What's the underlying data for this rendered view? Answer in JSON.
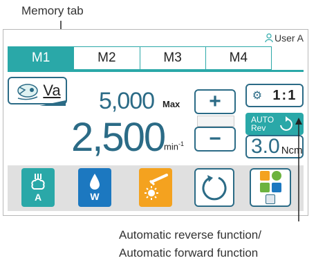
{
  "callouts": {
    "memory_tab": "Memory tab",
    "auto_reverse_line1": "Automatic reverse function/",
    "auto_reverse_line2": "Automatic forward  function"
  },
  "header": {
    "user_label": "User A"
  },
  "tabs": [
    {
      "label": "M1",
      "active": true
    },
    {
      "label": "M2",
      "active": false
    },
    {
      "label": "M3",
      "active": false
    },
    {
      "label": "M4",
      "active": false
    }
  ],
  "motor": {
    "mode_label": "Va",
    "max_speed": "5,000",
    "max_label": "Max",
    "speed": "2,500",
    "speed_unit": "min",
    "speed_unit_exp": "-1"
  },
  "controls": {
    "plus": "+",
    "minus": "−"
  },
  "ratio": {
    "value": "1:1"
  },
  "auto": {
    "line1": "AUTO",
    "line2": "Rev"
  },
  "torque": {
    "value": "3.0",
    "unit": "Ncm"
  },
  "bottom": {
    "air_label": "A",
    "water_label": "W"
  },
  "colors": {
    "teal": "#2aa8a8",
    "blue": "#1c78c0",
    "orange": "#f4a21f",
    "border": "#2b6b86"
  }
}
